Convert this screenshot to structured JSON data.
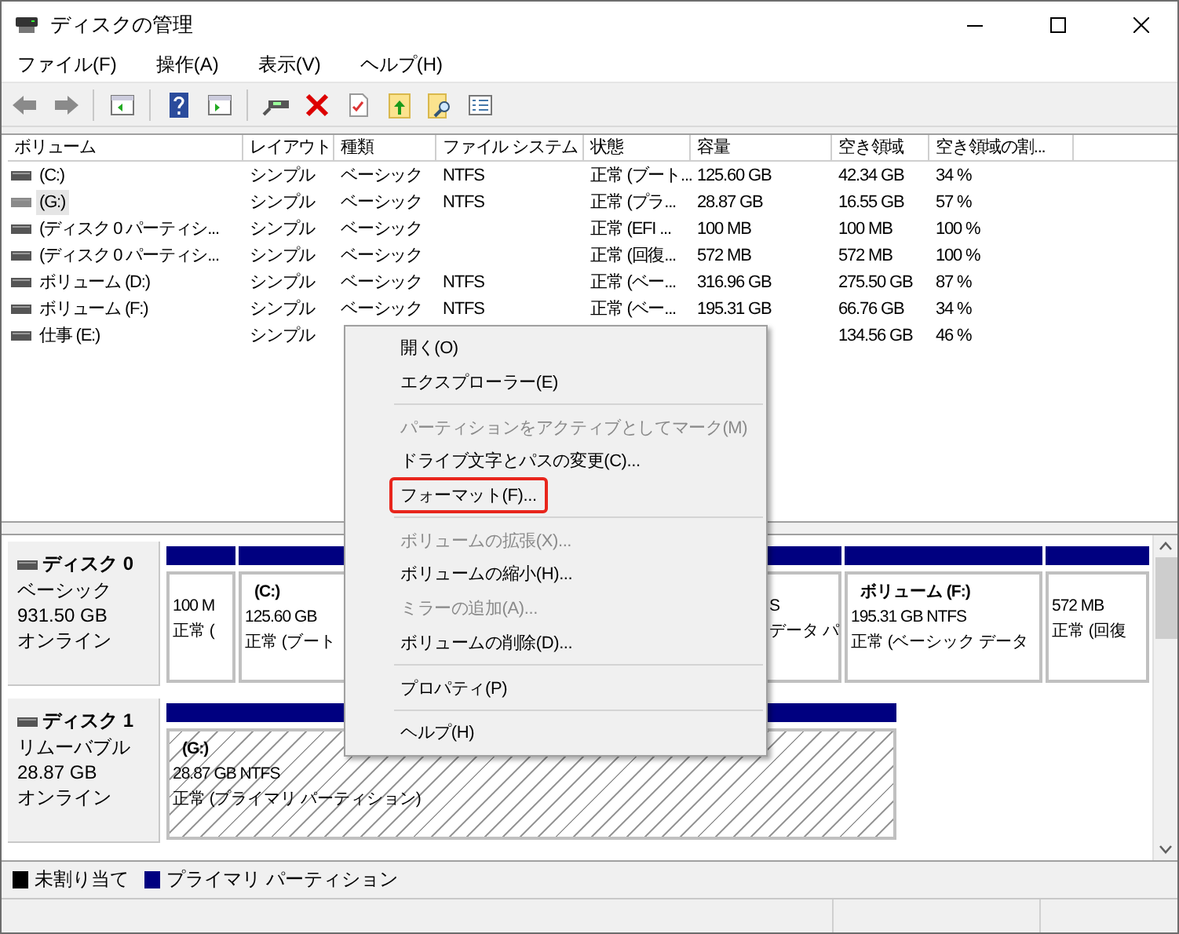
{
  "window": {
    "title": "ディスクの管理"
  },
  "menu_bar": [
    "ファイル(F)",
    "操作(A)",
    "表示(V)",
    "ヘルプ(H)"
  ],
  "table": {
    "columns": [
      "ボリューム",
      "レイアウト",
      "種類",
      "ファイル システム",
      "状態",
      "容量",
      "空き領域",
      "空き領域の割..."
    ],
    "rows": [
      {
        "selected": false,
        "cells": [
          "(C:)",
          "シンプル",
          "ベーシック",
          "NTFS",
          "正常 (ブート...",
          "125.60 GB",
          "42.34 GB",
          "34 %"
        ]
      },
      {
        "selected": true,
        "cells": [
          "(G:)",
          "シンプル",
          "ベーシック",
          "NTFS",
          "正常 (プラ...",
          "28.87 GB",
          "16.55 GB",
          "57 %"
        ]
      },
      {
        "selected": false,
        "cells": [
          "(ディスク 0 パーティシ...",
          "シンプル",
          "ベーシック",
          null,
          "正常 (EFI ...",
          "100 MB",
          "100 MB",
          "100 %"
        ]
      },
      {
        "selected": false,
        "cells": [
          "(ディスク 0 パーティシ...",
          "シンプル",
          "ベーシック",
          null,
          "正常 (回復...",
          "572 MB",
          "572 MB",
          "100 %"
        ]
      },
      {
        "selected": false,
        "cells": [
          "ボリューム (D:)",
          "シンプル",
          "ベーシック",
          "NTFS",
          "正常 (ベー...",
          "316.96 GB",
          "275.50 GB",
          "87 %"
        ]
      },
      {
        "selected": false,
        "cells": [
          "ボリューム (F:)",
          "シンプル",
          "ベーシック",
          "NTFS",
          "正常 (ベー...",
          "195.31 GB",
          "66.76 GB",
          "34 %"
        ]
      },
      {
        "selected": false,
        "cells": [
          "仕事 (E:)",
          "シンプル",
          null,
          null,
          null,
          null,
          "134.56 GB",
          "46 %"
        ]
      }
    ]
  },
  "disks": [
    {
      "name": "ディスク 0",
      "info": [
        "ベーシック",
        "931.50 GB",
        "オンライン"
      ],
      "partitions": [
        {
          "selected": false,
          "lines": [
            "100 M",
            "正常 ("
          ]
        },
        {
          "selected": false,
          "title": "(C:)",
          "lines": [
            "125.60 GB",
            "正常 (ブート"
          ]
        },
        {
          "selected": false,
          "lines": [
            "S",
            "データ パ"
          ]
        },
        {
          "selected": false,
          "title": "ボリューム  (F:)",
          "lines": [
            "195.31 GB NTFS",
            "正常 (ベーシック データ"
          ]
        },
        {
          "selected": false,
          "lines": [
            "572 MB",
            "正常 (回復"
          ]
        }
      ]
    },
    {
      "name": "ディスク 1",
      "info": [
        "リムーバブル",
        "28.87 GB",
        "オンライン"
      ],
      "partitions": [
        {
          "selected": true,
          "title": "(G:)",
          "lines": [
            "28.87 GB NTFS",
            "正常 (プライマリ パーティション)"
          ]
        }
      ]
    }
  ],
  "legend": [
    {
      "label": "未割り当て",
      "color": "#000000"
    },
    {
      "label": "プライマリ パーティション",
      "color": "#000080"
    }
  ],
  "context_menu": [
    {
      "kind": "item",
      "label": "開く(O)",
      "disabled": false,
      "highlighted": false
    },
    {
      "kind": "item",
      "label": "エクスプローラー(E)",
      "disabled": false,
      "highlighted": false
    },
    {
      "kind": "separator"
    },
    {
      "kind": "item",
      "label": "パーティションをアクティブとしてマーク(M)",
      "disabled": true,
      "highlighted": false
    },
    {
      "kind": "item",
      "label": "ドライブ文字とパスの変更(C)...",
      "disabled": false,
      "highlighted": false
    },
    {
      "kind": "item",
      "label": "フォーマット(F)...",
      "disabled": false,
      "highlighted": true
    },
    {
      "kind": "separator"
    },
    {
      "kind": "item",
      "label": "ボリュームの拡張(X)...",
      "disabled": true,
      "highlighted": false
    },
    {
      "kind": "item",
      "label": "ボリュームの縮小(H)...",
      "disabled": false,
      "highlighted": false
    },
    {
      "kind": "item",
      "label": "ミラーの追加(A)...",
      "disabled": true,
      "highlighted": false
    },
    {
      "kind": "item",
      "label": "ボリュームの削除(D)...",
      "disabled": false,
      "highlighted": false
    },
    {
      "kind": "separator"
    },
    {
      "kind": "item",
      "label": "プロパティ(P)",
      "disabled": false,
      "highlighted": false
    },
    {
      "kind": "separator"
    },
    {
      "kind": "item",
      "label": "ヘルプ(H)",
      "disabled": false,
      "highlighted": false
    }
  ]
}
